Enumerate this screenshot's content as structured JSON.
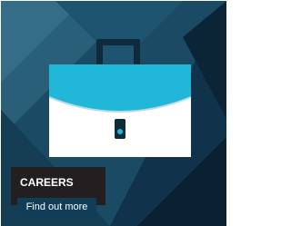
{
  "tile": {
    "title": "CAREERS",
    "button_label": "Find out more",
    "icon": "briefcase-icon"
  },
  "colors": {
    "background_dark": "#0d2a3b",
    "background_mid": "#1b4a64",
    "background_light": "#2c6480",
    "briefcase_top": "#21b7d8",
    "briefcase_body": "#ffffff",
    "briefcase_handle": "#0e2a3b",
    "caption_bg": "#231e1f",
    "button_bg": "#103e59"
  }
}
